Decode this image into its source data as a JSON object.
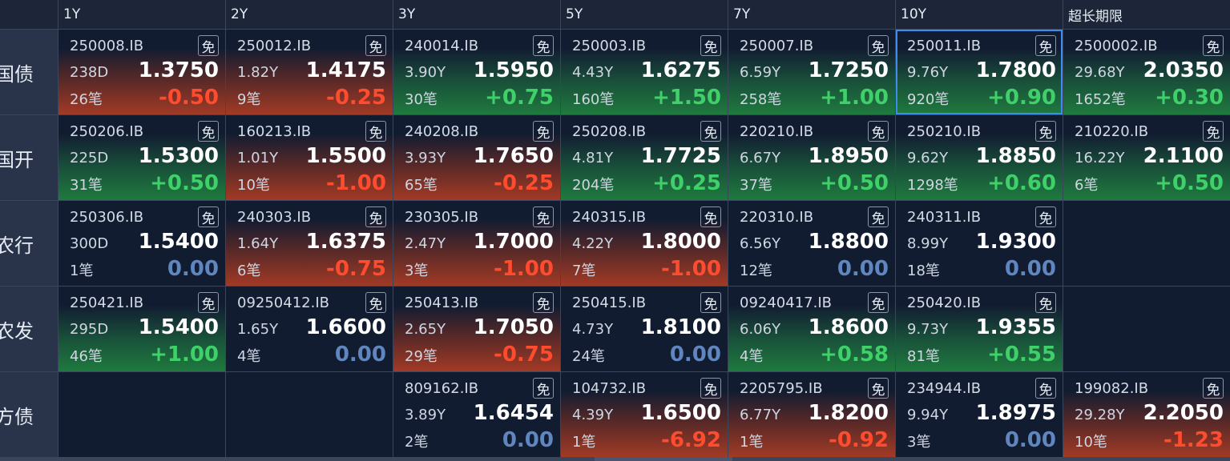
{
  "header": {
    "columns": [
      "1Y",
      "2Y",
      "3Y",
      "5Y",
      "7Y",
      "10Y",
      "超长期限"
    ]
  },
  "rows": [
    {
      "label": "国债",
      "cells": [
        {
          "code": "250008.IB",
          "badge": "免",
          "term": "238D",
          "yield": "1.3750",
          "count": "26笔",
          "change": "-0.50",
          "trend": "down"
        },
        {
          "code": "250012.IB",
          "badge": "免",
          "term": "1.82Y",
          "yield": "1.4175",
          "count": "9笔",
          "change": "-0.25",
          "trend": "down"
        },
        {
          "code": "240014.IB",
          "badge": "免",
          "term": "3.90Y",
          "yield": "1.5950",
          "count": "30笔",
          "change": "+0.75",
          "trend": "up"
        },
        {
          "code": "250003.IB",
          "badge": "免",
          "term": "4.43Y",
          "yield": "1.6275",
          "count": "160笔",
          "change": "+1.50",
          "trend": "up"
        },
        {
          "code": "250007.IB",
          "badge": "免",
          "term": "6.59Y",
          "yield": "1.7250",
          "count": "258笔",
          "change": "+1.00",
          "trend": "up"
        },
        {
          "code": "250011.IB",
          "badge": "免",
          "term": "9.76Y",
          "yield": "1.7800",
          "count": "920笔",
          "change": "+0.90",
          "trend": "up",
          "selected": true
        },
        {
          "code": "2500002.IB",
          "badge": "免",
          "term": "29.68Y",
          "yield": "2.0350",
          "count": "1652笔",
          "change": "+0.30",
          "trend": "up"
        }
      ]
    },
    {
      "label": "国开",
      "cells": [
        {
          "code": "250206.IB",
          "badge": "免",
          "term": "225D",
          "yield": "1.5300",
          "count": "31笔",
          "change": "+0.50",
          "trend": "up"
        },
        {
          "code": "160213.IB",
          "badge": "免",
          "term": "1.01Y",
          "yield": "1.5500",
          "count": "10笔",
          "change": "-1.00",
          "trend": "down"
        },
        {
          "code": "240208.IB",
          "badge": "免",
          "term": "3.93Y",
          "yield": "1.7650",
          "count": "65笔",
          "change": "-0.25",
          "trend": "down"
        },
        {
          "code": "250208.IB",
          "badge": "免",
          "term": "4.81Y",
          "yield": "1.7725",
          "count": "204笔",
          "change": "+0.25",
          "trend": "up"
        },
        {
          "code": "220210.IB",
          "badge": "免",
          "term": "6.67Y",
          "yield": "1.8950",
          "count": "37笔",
          "change": "+0.50",
          "trend": "up"
        },
        {
          "code": "250210.IB",
          "badge": "免",
          "term": "9.62Y",
          "yield": "1.8850",
          "count": "1298笔",
          "change": "+0.60",
          "trend": "up"
        },
        {
          "code": "210220.IB",
          "badge": "免",
          "term": "16.22Y",
          "yield": "2.1100",
          "count": "6笔",
          "change": "+0.50",
          "trend": "up"
        }
      ]
    },
    {
      "label": "农行",
      "cells": [
        {
          "code": "250306.IB",
          "badge": "免",
          "term": "300D",
          "yield": "1.5400",
          "count": "1笔",
          "change": "0.00",
          "trend": "flat"
        },
        {
          "code": "240303.IB",
          "badge": "免",
          "term": "1.64Y",
          "yield": "1.6375",
          "count": "6笔",
          "change": "-0.75",
          "trend": "down"
        },
        {
          "code": "230305.IB",
          "badge": "免",
          "term": "2.47Y",
          "yield": "1.7000",
          "count": "3笔",
          "change": "-1.00",
          "trend": "down"
        },
        {
          "code": "240315.IB",
          "badge": "免",
          "term": "4.22Y",
          "yield": "1.8000",
          "count": "7笔",
          "change": "-1.00",
          "trend": "down"
        },
        {
          "code": "220310.IB",
          "badge": "免",
          "term": "6.56Y",
          "yield": "1.8800",
          "count": "12笔",
          "change": "0.00",
          "trend": "flat"
        },
        {
          "code": "240311.IB",
          "badge": "免",
          "term": "8.99Y",
          "yield": "1.9300",
          "count": "18笔",
          "change": "0.00",
          "trend": "flat"
        },
        null
      ]
    },
    {
      "label": "农发",
      "cells": [
        {
          "code": "250421.IB",
          "badge": "免",
          "term": "295D",
          "yield": "1.5400",
          "count": "46笔",
          "change": "+1.00",
          "trend": "up"
        },
        {
          "code": "09250412.IB",
          "badge": "免",
          "term": "1.65Y",
          "yield": "1.6600",
          "count": "4笔",
          "change": "0.00",
          "trend": "flat"
        },
        {
          "code": "250413.IB",
          "badge": "免",
          "term": "2.65Y",
          "yield": "1.7050",
          "count": "29笔",
          "change": "-0.75",
          "trend": "down"
        },
        {
          "code": "250415.IB",
          "badge": "免",
          "term": "4.73Y",
          "yield": "1.8100",
          "count": "24笔",
          "change": "0.00",
          "trend": "flat"
        },
        {
          "code": "09240417.IB",
          "badge": "免",
          "term": "6.06Y",
          "yield": "1.8600",
          "count": "4笔",
          "change": "+0.58",
          "trend": "up"
        },
        {
          "code": "250420.IB",
          "badge": "免",
          "term": "9.73Y",
          "yield": "1.9355",
          "count": "81笔",
          "change": "+0.55",
          "trend": "up"
        },
        null
      ]
    },
    {
      "label": "地方债",
      "cells": [
        null,
        null,
        {
          "code": "809162.IB",
          "badge": "免",
          "term": "3.89Y",
          "yield": "1.6454",
          "count": "2笔",
          "change": "0.00",
          "trend": "flat"
        },
        {
          "code": "104732.IB",
          "badge": "免",
          "term": "4.39Y",
          "yield": "1.6500",
          "count": "1笔",
          "change": "-6.92",
          "trend": "down"
        },
        {
          "code": "2205795.IB",
          "badge": "免",
          "term": "6.77Y",
          "yield": "1.8200",
          "count": "1笔",
          "change": "-0.92",
          "trend": "down"
        },
        {
          "code": "234944.IB",
          "badge": "免",
          "term": "9.94Y",
          "yield": "1.8975",
          "count": "3笔",
          "change": "0.00",
          "trend": "flat"
        },
        {
          "code": "199082.IB",
          "badge": "免",
          "term": "29.28Y",
          "yield": "2.2050",
          "count": "10笔",
          "change": "-1.23",
          "trend": "down"
        }
      ]
    }
  ]
}
